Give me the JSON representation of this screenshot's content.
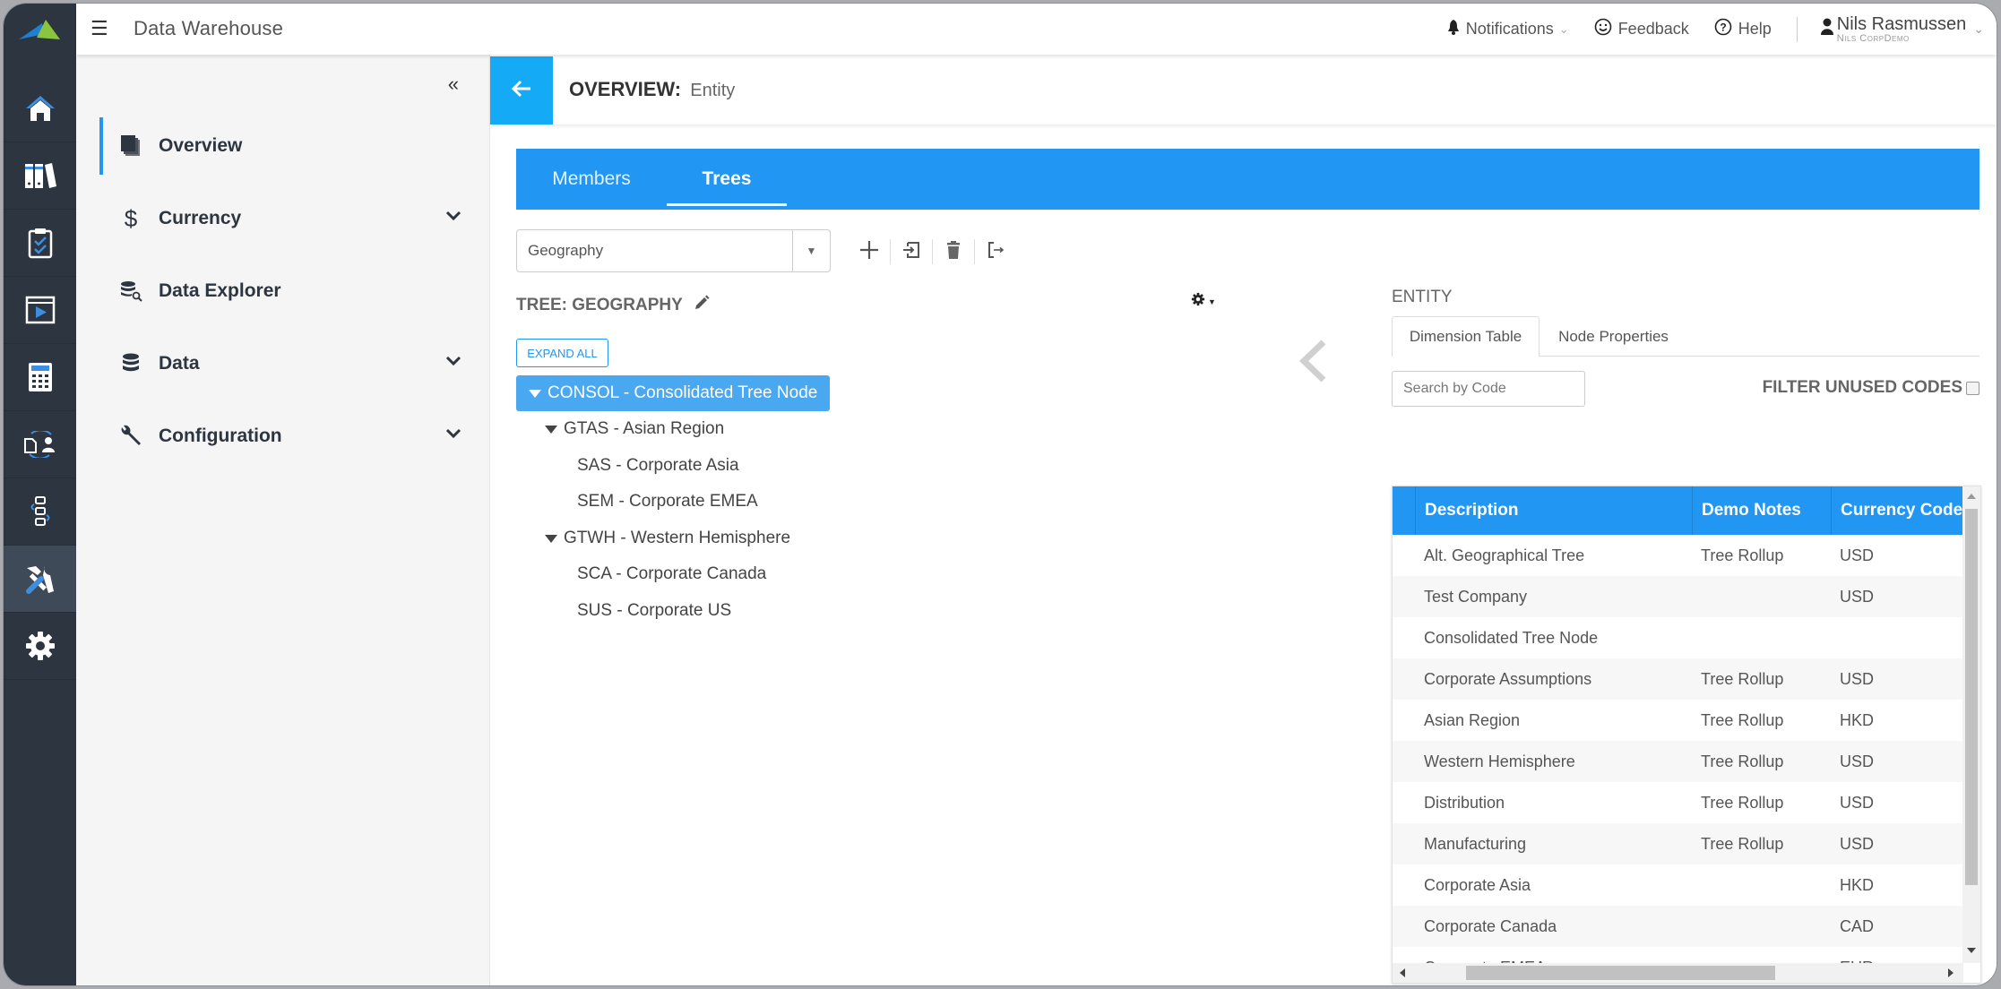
{
  "app": {
    "title": "Data Warehouse",
    "menu_icon": "hamburger-icon",
    "logo": "brand-logo"
  },
  "topbar": {
    "notifications_label": "Notifications",
    "feedback_label": "Feedback",
    "help_label": "Help",
    "user_name": "Nils Rasmussen",
    "user_org": "Nils CorpDemo"
  },
  "rail": {
    "items": [
      {
        "icon": "home-icon",
        "active": false
      },
      {
        "icon": "binders-icon",
        "active": false
      },
      {
        "icon": "clipboard-check-icon",
        "active": false
      },
      {
        "icon": "presentation-play-icon",
        "active": false
      },
      {
        "icon": "calculator-icon",
        "active": false
      },
      {
        "icon": "document-user-sync-icon",
        "active": false
      },
      {
        "icon": "workflow-icon",
        "active": false
      },
      {
        "icon": "tools-icon",
        "active": true
      },
      {
        "icon": "gear-icon",
        "active": false
      }
    ]
  },
  "sidebar": {
    "collapse_icon": "double-chevron-left-icon",
    "items": [
      {
        "label": "Overview",
        "icon": "copy-icon",
        "active": true,
        "expandable": false
      },
      {
        "label": "Currency",
        "icon": "dollar-icon",
        "active": false,
        "expandable": true
      },
      {
        "label": "Data Explorer",
        "icon": "database-search-icon",
        "active": false,
        "expandable": false
      },
      {
        "label": "Data",
        "icon": "database-icon",
        "active": false,
        "expandable": true
      },
      {
        "label": "Configuration",
        "icon": "wrench-icon",
        "active": false,
        "expandable": true
      }
    ]
  },
  "header": {
    "title_prefix": "OVERVIEW:",
    "title_subject": "Entity"
  },
  "tabs": [
    {
      "label": "Members",
      "active": false
    },
    {
      "label": "Trees",
      "active": true
    }
  ],
  "tree_selector": {
    "value": "Geography"
  },
  "toolbar": {
    "buttons": [
      "add-icon",
      "import-icon",
      "trash-icon",
      "export-icon"
    ]
  },
  "tree": {
    "title": "TREE: GEOGRAPHY",
    "expand_all_label": "EXPAND ALL",
    "nodes": [
      {
        "label": "CONSOL - Consolidated Tree Node",
        "level": 0,
        "expanded": true,
        "selected": true
      },
      {
        "label": "GTAS - Asian Region",
        "level": 1,
        "expanded": true,
        "selected": false
      },
      {
        "label": "SAS - Corporate Asia",
        "level": 2,
        "expanded": null,
        "selected": false
      },
      {
        "label": "SEM - Corporate EMEA",
        "level": 2,
        "expanded": null,
        "selected": false
      },
      {
        "label": "GTWH - Western Hemisphere",
        "level": 1,
        "expanded": true,
        "selected": false
      },
      {
        "label": "SCA - Corporate Canada",
        "level": 2,
        "expanded": null,
        "selected": false
      },
      {
        "label": "SUS - Corporate US",
        "level": 2,
        "expanded": null,
        "selected": false
      }
    ]
  },
  "entity_panel": {
    "title": "ENTITY",
    "tabs": [
      {
        "label": "Dimension Table",
        "active": true
      },
      {
        "label": "Node Properties",
        "active": false
      }
    ],
    "search_placeholder": "Search by Code",
    "filter_label": "FILTER UNUSED CODES",
    "filter_checked": false,
    "columns": [
      "Description",
      "Demo Notes",
      "Currency Code"
    ],
    "rows": [
      [
        "Alt. Geographical Tree",
        "Tree Rollup",
        "USD"
      ],
      [
        "Test Company",
        "",
        "USD"
      ],
      [
        "Consolidated Tree Node",
        "",
        ""
      ],
      [
        "Corporate Assumptions",
        "Tree Rollup",
        "USD"
      ],
      [
        "Asian Region",
        "Tree Rollup",
        "HKD"
      ],
      [
        "Western Hemisphere",
        "Tree Rollup",
        "USD"
      ],
      [
        "Distribution",
        "Tree Rollup",
        "USD"
      ],
      [
        "Manufacturing",
        "Tree Rollup",
        "USD"
      ],
      [
        "Corporate Asia",
        "",
        "HKD"
      ],
      [
        "Corporate Canada",
        "",
        "CAD"
      ],
      [
        "Corporate EMEA",
        "",
        "EUR"
      ]
    ]
  },
  "colors": {
    "accent": "#2196f3",
    "back_button": "#14aaf5",
    "rail_bg": "#2c3540",
    "selected_node": "#4aa8f0"
  }
}
